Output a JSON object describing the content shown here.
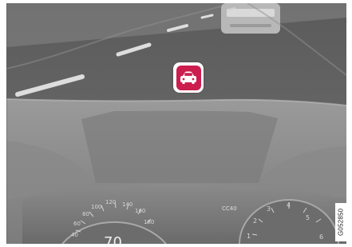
{
  "image": {
    "id_text": "G052850",
    "cluster_text": "CC40",
    "speed_ticks": [
      "40",
      "60",
      "80",
      "100",
      "120",
      "140",
      "160",
      "180"
    ],
    "speed_partial": "70",
    "rpm_ticks": [
      "1",
      "2",
      "3",
      "4",
      "5",
      "6"
    ]
  },
  "icons": {
    "vehicle_ahead": "car-front-icon",
    "accent": "#cc1d4f"
  }
}
